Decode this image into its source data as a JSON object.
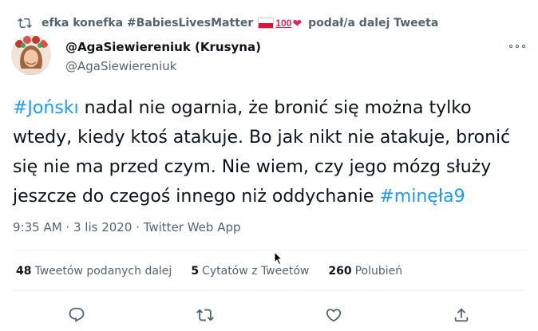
{
  "retweet": {
    "icon": "retweet-icon",
    "name": "efka konefka #BabiesLivesMatter",
    "emoji_hundred": "100",
    "suffix": "podał/a dalej Tweeta"
  },
  "tweet": {
    "display_name": "@AgaSiewiereniuk (Krusyna)",
    "handle": "@AgaSiewiereniuk",
    "text_parts": {
      "hashtag1": "#Jońskı",
      "line1": " nadal nie ogarnia, że bronić się można tylko",
      "line2": "wtedy, kiedy ktoś atakuje. Bo jak nikt nie atakuje, bronić",
      "line3": "się nie ma przed czym. Nie wiem, czy jego mózg służy",
      "line4": "jeszcze do czegoś innego niż oddychanie ",
      "hashtag2": "#minęła9"
    },
    "time": "9:35 AM",
    "date": "3 lis 2020",
    "source": "Twitter Web App",
    "separator": " · "
  },
  "stats": {
    "retweets": {
      "count": "48",
      "label": "Tweetów podanych dalej"
    },
    "quotes": {
      "count": "5",
      "label": "Cytatów z Tweetów"
    },
    "likes": {
      "count": "260",
      "label": "Polubień"
    }
  },
  "actions": [
    "reply-icon",
    "retweet-icon",
    "like-icon",
    "share-icon"
  ],
  "colors": {
    "hashtag": "#1d9bf0",
    "secondary_text": "#536471",
    "heart": "#e0245e"
  }
}
